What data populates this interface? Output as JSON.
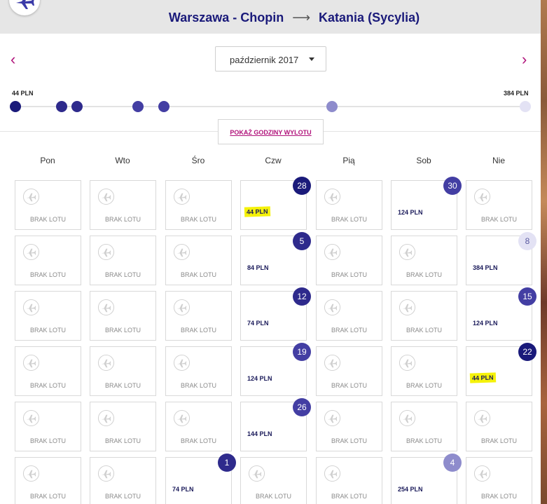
{
  "header": {
    "origin": "Warszawa - Chopin",
    "arrow": "⟶",
    "destination": "Katania (Sycylia)"
  },
  "month": {
    "selected": "październik 2017"
  },
  "nav": {
    "prev": "‹",
    "next": "›"
  },
  "price_scale": {
    "min_label": "44 PLN",
    "max_label": "384 PLN"
  },
  "show_hours_label": "POKAŻ GODZINY WYLOTU",
  "weekdays": [
    "Pon",
    "Wto",
    "Śro",
    "Czw",
    "Pią",
    "Sob",
    "Nie"
  ],
  "no_flight_label": "BRAK LOTU",
  "colors": {
    "cheapest": "#1a1a7a",
    "cheap": "#2e2a8c",
    "mid": "#433ea3",
    "high": "#8e8ccc",
    "highest": "#e3e2f4",
    "highlight": "#f5f20a",
    "accent": "#b0127a"
  },
  "calendar": [
    [
      {
        "type": "none"
      },
      {
        "type": "none"
      },
      {
        "type": "none"
      },
      {
        "type": "flight",
        "day": "28",
        "price": "44 PLN",
        "tier": "cheapest",
        "highlight": true
      },
      {
        "type": "none"
      },
      {
        "type": "flight",
        "day": "30",
        "price": "124 PLN",
        "tier": "mid"
      },
      {
        "type": "none"
      }
    ],
    [
      {
        "type": "none"
      },
      {
        "type": "none"
      },
      {
        "type": "none"
      },
      {
        "type": "flight",
        "day": "5",
        "price": "84 PLN",
        "tier": "cheap"
      },
      {
        "type": "none"
      },
      {
        "type": "none"
      },
      {
        "type": "flight",
        "day": "8",
        "price": "384 PLN",
        "tier": "highest"
      }
    ],
    [
      {
        "type": "none"
      },
      {
        "type": "none"
      },
      {
        "type": "none"
      },
      {
        "type": "flight",
        "day": "12",
        "price": "74 PLN",
        "tier": "cheap"
      },
      {
        "type": "none"
      },
      {
        "type": "none"
      },
      {
        "type": "flight",
        "day": "15",
        "price": "124 PLN",
        "tier": "mid"
      }
    ],
    [
      {
        "type": "none"
      },
      {
        "type": "none"
      },
      {
        "type": "none"
      },
      {
        "type": "flight",
        "day": "19",
        "price": "124 PLN",
        "tier": "mid"
      },
      {
        "type": "none"
      },
      {
        "type": "none"
      },
      {
        "type": "flight",
        "day": "22",
        "price": "44 PLN",
        "tier": "cheapest",
        "highlight": true
      }
    ],
    [
      {
        "type": "none"
      },
      {
        "type": "none"
      },
      {
        "type": "none"
      },
      {
        "type": "flight",
        "day": "26",
        "price": "144 PLN",
        "tier": "mid"
      },
      {
        "type": "none"
      },
      {
        "type": "none"
      },
      {
        "type": "none"
      }
    ],
    [
      {
        "type": "none"
      },
      {
        "type": "none"
      },
      {
        "type": "flight",
        "day": "1",
        "price": "74 PLN",
        "tier": "cheap"
      },
      {
        "type": "none"
      },
      {
        "type": "none"
      },
      {
        "type": "flight",
        "day": "4",
        "price": "254 PLN",
        "tier": "high"
      },
      {
        "type": "none"
      }
    ]
  ],
  "scale_dots": [
    {
      "price": 44,
      "tier": "cheapest"
    },
    {
      "price": 74,
      "tier": "cheap"
    },
    {
      "price": 84,
      "tier": "cheap"
    },
    {
      "price": 124,
      "tier": "mid"
    },
    {
      "price": 144,
      "tier": "mid"
    },
    {
      "price": 254,
      "tier": "high"
    },
    {
      "price": 384,
      "tier": "highest"
    }
  ]
}
